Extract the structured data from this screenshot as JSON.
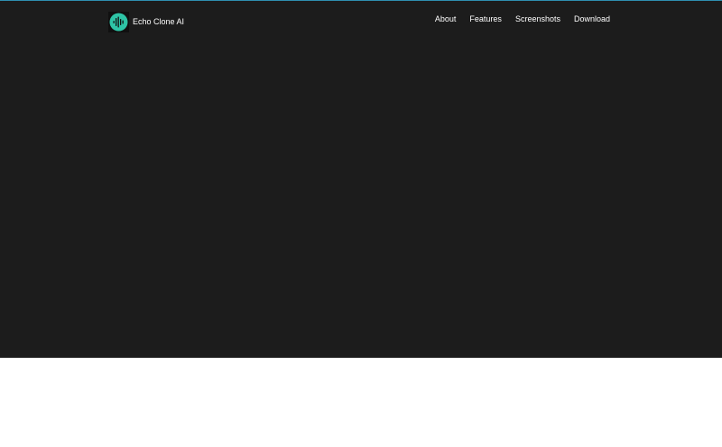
{
  "brand": {
    "name": "Echo Clone AI",
    "logo_icon": "soundwave-icon",
    "logo_color": "#2ec4a6"
  },
  "nav": {
    "items": [
      {
        "label": "About"
      },
      {
        "label": "Features"
      },
      {
        "label": "Screenshots"
      },
      {
        "label": "Download"
      }
    ]
  },
  "colors": {
    "hero_background": "#1c1c1c",
    "accent_line": "#2f8fb0",
    "page_background": "#ffffff"
  }
}
